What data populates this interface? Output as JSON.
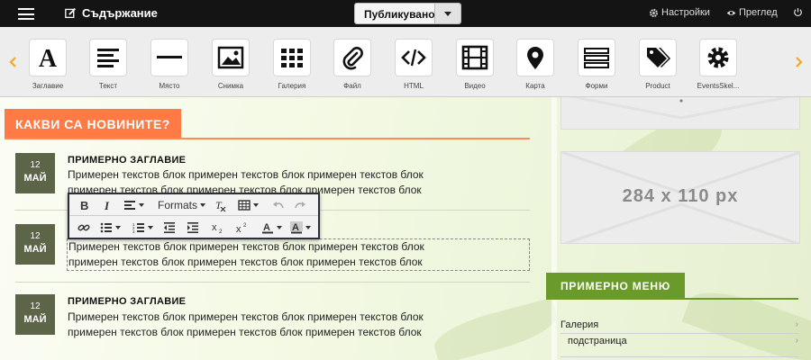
{
  "topbar": {
    "contents_label": "Съдържание",
    "publish_label": "Публикувано",
    "settings_label": "Настройки",
    "preview_label": "Преглед"
  },
  "widgets": [
    {
      "label": "Заглавие",
      "icon": "heading-icon"
    },
    {
      "label": "Текст",
      "icon": "text-icon"
    },
    {
      "label": "Място",
      "icon": "spacer-icon"
    },
    {
      "label": "Снимка",
      "icon": "image-icon"
    },
    {
      "label": "Галерия",
      "icon": "gallery-icon"
    },
    {
      "label": "Файл",
      "icon": "paperclip-icon"
    },
    {
      "label": "HTML",
      "icon": "code-icon"
    },
    {
      "label": "Видео",
      "icon": "film-icon"
    },
    {
      "label": "Карта",
      "icon": "map-pin-icon"
    },
    {
      "label": "Форми",
      "icon": "form-icon"
    },
    {
      "label": "Product",
      "icon": "tags-icon"
    },
    {
      "label": "EventsSkel...",
      "icon": "gear-icon"
    }
  ],
  "news": {
    "heading": "КАКВИ СА НОВИНИТЕ?",
    "articles": [
      {
        "day": "12",
        "month": "МАЙ",
        "title": "ПРИМЕРНО ЗАГЛАВИЕ",
        "line1": "Примерен текстов блок примерен текстов блок примерен текстов блок",
        "line2": "примерен текстов блок примерен текстов блок примерен текстов блок"
      },
      {
        "day": "12",
        "month": "МАЙ",
        "title": "",
        "line1": "Примерен текстов блок примерен текстов блок примерен текстов блок",
        "line2": "примерен текстов блок примерен текстов блок примерен текстов блок"
      },
      {
        "day": "12",
        "month": "МАЙ",
        "title": "ПРИМЕРНО ЗАГЛАВИЕ",
        "line1": "Примерен текстов блок примерен текстов блок примерен текстов блок",
        "line2": "примерен текстов блок примерен текстов блок примерен текстов блок"
      }
    ]
  },
  "toolbar": {
    "formats_label": "Formats"
  },
  "sidebar": {
    "placeholder_text": "284 x 110 px",
    "menu_heading": "ПРИМЕРНО МЕНЮ",
    "menu_items": [
      "Галерия",
      "подстраница"
    ]
  },
  "colors": {
    "news_accent": "#ff7a45",
    "menu_accent": "#6a9a2a",
    "date_badge": "#5d6548",
    "toolbar_border": "#2c2f3a",
    "scroll_arrow": "#f5a623"
  }
}
